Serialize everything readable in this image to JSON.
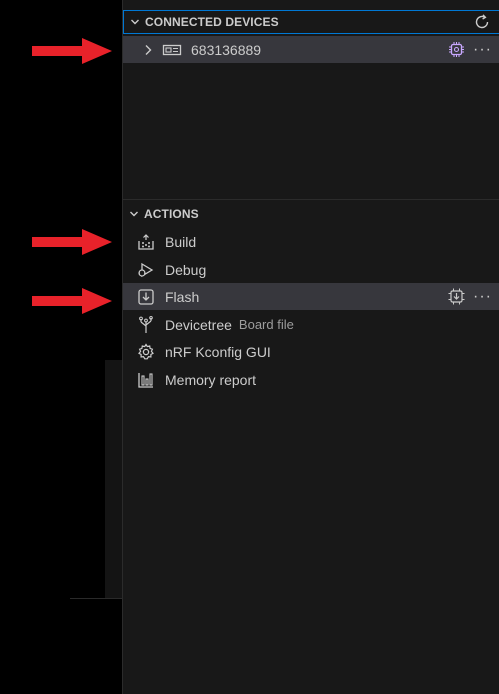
{
  "connected_devices": {
    "title": "CONNECTED DEVICES",
    "refresh_icon": "refresh-icon",
    "devices": [
      {
        "serial": "683136889",
        "icon": "device-icon"
      }
    ]
  },
  "actions": {
    "title": "ACTIONS",
    "items": [
      {
        "label": "Build",
        "icon": "build-icon",
        "description": ""
      },
      {
        "label": "Debug",
        "icon": "debug-icon",
        "description": ""
      },
      {
        "label": "Flash",
        "icon": "flash-icon",
        "description": ""
      },
      {
        "label": "Devicetree",
        "icon": "devicetree-icon",
        "description": "Board file"
      },
      {
        "label": "nRF Kconfig GUI",
        "icon": "gear-icon",
        "description": ""
      },
      {
        "label": "Memory report",
        "icon": "memory-report-icon",
        "description": ""
      }
    ]
  },
  "colors": {
    "panel_bg": "#181818",
    "selection_bg": "#37373d",
    "focus_border": "#0078d4",
    "annotation_arrow": "#e8222a"
  }
}
